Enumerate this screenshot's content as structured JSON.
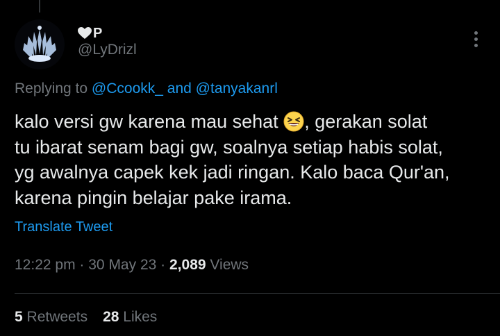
{
  "author": {
    "display_name": "P",
    "display_name_icon": "heart-icon",
    "handle": "@LyDrizl",
    "avatar": "avatar-image"
  },
  "reply": {
    "prefix": "Replying to",
    "user1": "@Ccookk_",
    "conjunction": "and",
    "user2": "@tanyakanrl"
  },
  "tweet": {
    "line1_before_emoji": "kalo versi gw karena mau sehat",
    "emoji": "grinning-squinting-face-emoji",
    "line1_after_emoji": ", gerakan solat",
    "line2": "tu ibarat senam bagi gw, soalnya setiap habis solat,",
    "line3": "yg awalnya capek kek jadi ringan. Kalo baca Qur'an,",
    "line4": "karena pingin belajar pake irama."
  },
  "translate_label": "Translate Tweet",
  "meta": {
    "time": "12:22 pm",
    "separator": "·",
    "date": "30 May 23",
    "views_count": "2,089",
    "views_label": "Views"
  },
  "stats": {
    "retweets_count": "5",
    "retweets_label": "Retweets",
    "likes_count": "28",
    "likes_label": "Likes"
  },
  "colors": {
    "background": "#000000",
    "text_primary": "#e7e9ea",
    "text_secondary": "#71767b",
    "link": "#1d9bf0",
    "divider": "#2f3336"
  },
  "icons": {
    "more": "more-dots-icon"
  }
}
